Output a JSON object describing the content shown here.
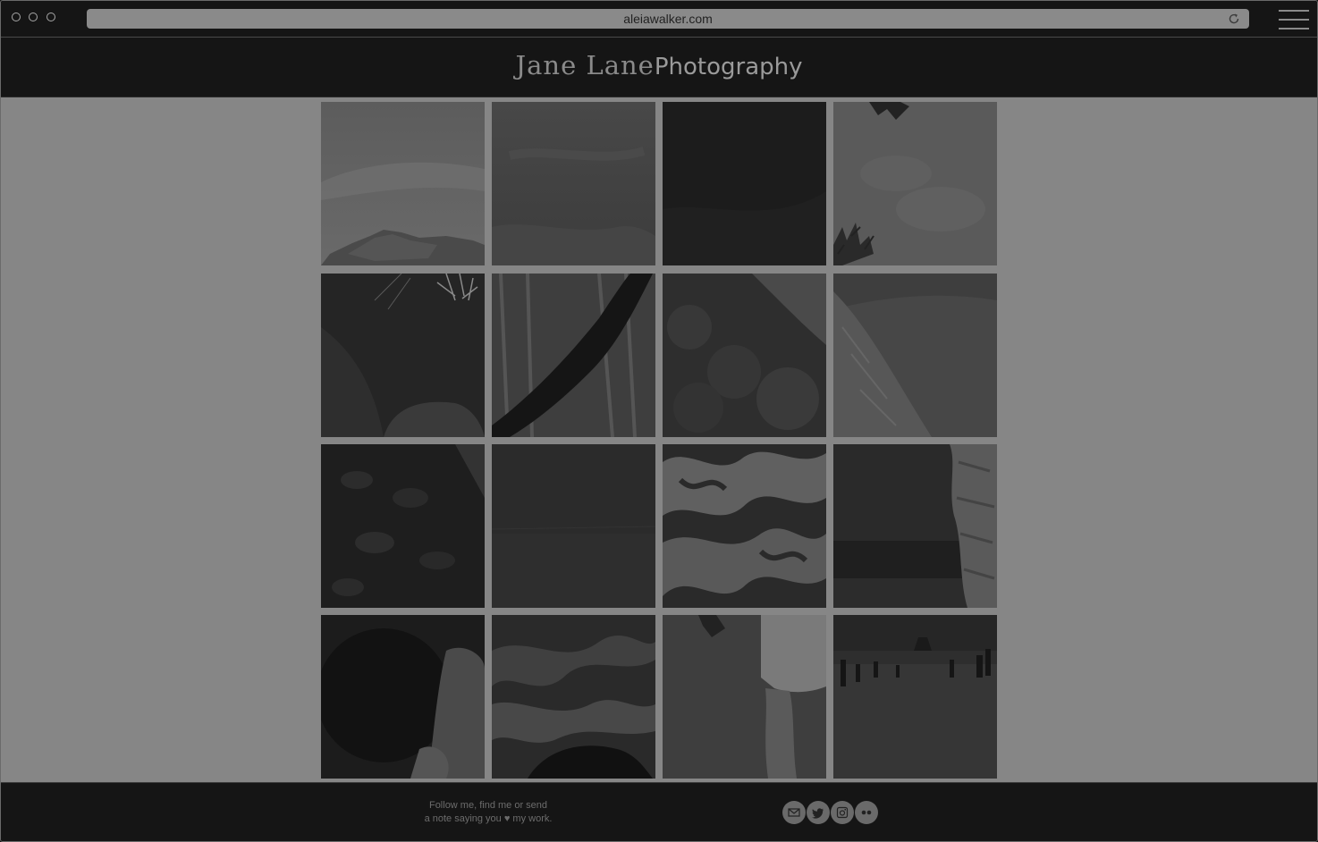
{
  "browser": {
    "url": "aleiawalker.com"
  },
  "header": {
    "logo_name": "Jane Lane",
    "logo_word": "Photography"
  },
  "gallery": {
    "photos": [
      {
        "subject": "sky-over-rocky-hill"
      },
      {
        "subject": "cloudy-sky"
      },
      {
        "subject": "dark-sky"
      },
      {
        "subject": "water-reflection-with-branches"
      },
      {
        "subject": "sparkler-and-fur-hood"
      },
      {
        "subject": "tree-trunk-in-bamboo-forest"
      },
      {
        "subject": "jungle-cliff"
      },
      {
        "subject": "rocky-ridge"
      },
      {
        "subject": "leafy-plants"
      },
      {
        "subject": "dark-sea"
      },
      {
        "subject": "foaming-waves"
      },
      {
        "subject": "sea-horizon-with-palm-trunk"
      },
      {
        "subject": "person-close-up"
      },
      {
        "subject": "waves-on-rocks"
      },
      {
        "subject": "legs-on-beach"
      },
      {
        "subject": "crowded-beach"
      }
    ]
  },
  "footer": {
    "line1": "Follow me, find me or send",
    "line2": "a note saying you ♥ my work.",
    "social": [
      {
        "icon": "mail-icon"
      },
      {
        "icon": "twitter-icon"
      },
      {
        "icon": "instagram-icon"
      },
      {
        "icon": "flickr-icon"
      }
    ]
  }
}
